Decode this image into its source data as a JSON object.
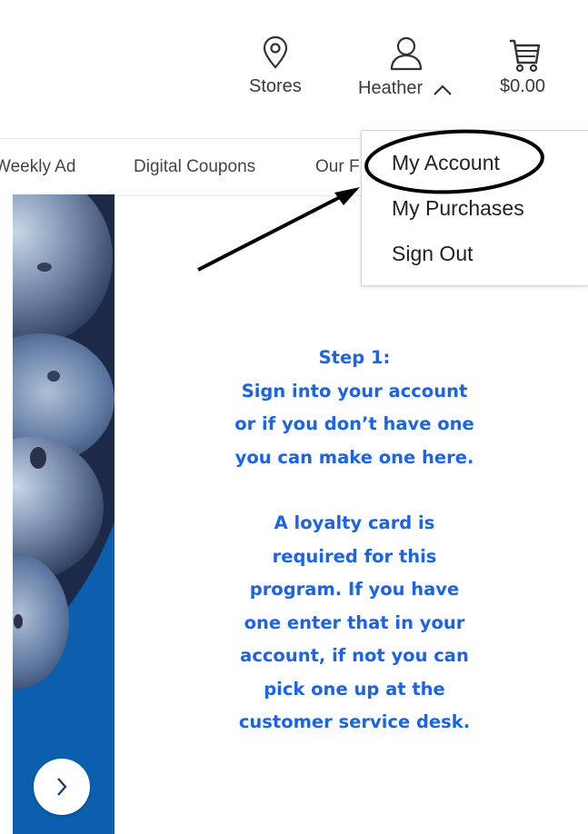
{
  "header": {
    "stores_label": "Stores",
    "user_label": "Heather",
    "cart_total": "$0.00",
    "icons": [
      "location-pin-icon",
      "user-icon",
      "chevron-up-icon",
      "cart-icon"
    ]
  },
  "nav": {
    "items": [
      "Weekly Ad",
      "Digital Coupons",
      "Our F"
    ]
  },
  "account_menu": {
    "items": [
      "My Account",
      "My Purchases",
      "Sign Out"
    ]
  },
  "hero": {
    "next_icon": "chevron-right-icon",
    "accent_color": "#0b5fae"
  },
  "instructions": {
    "color": "#1c63e6",
    "step_lines": [
      "Step 1:",
      "Sign into your account",
      "or if you don’t have one",
      "you can make one here."
    ],
    "card_lines": [
      "A loyalty card is",
      "required for this",
      "program. If you have",
      "one enter that in your",
      "account, if not you can",
      "pick one up at the",
      "customer service desk."
    ]
  }
}
